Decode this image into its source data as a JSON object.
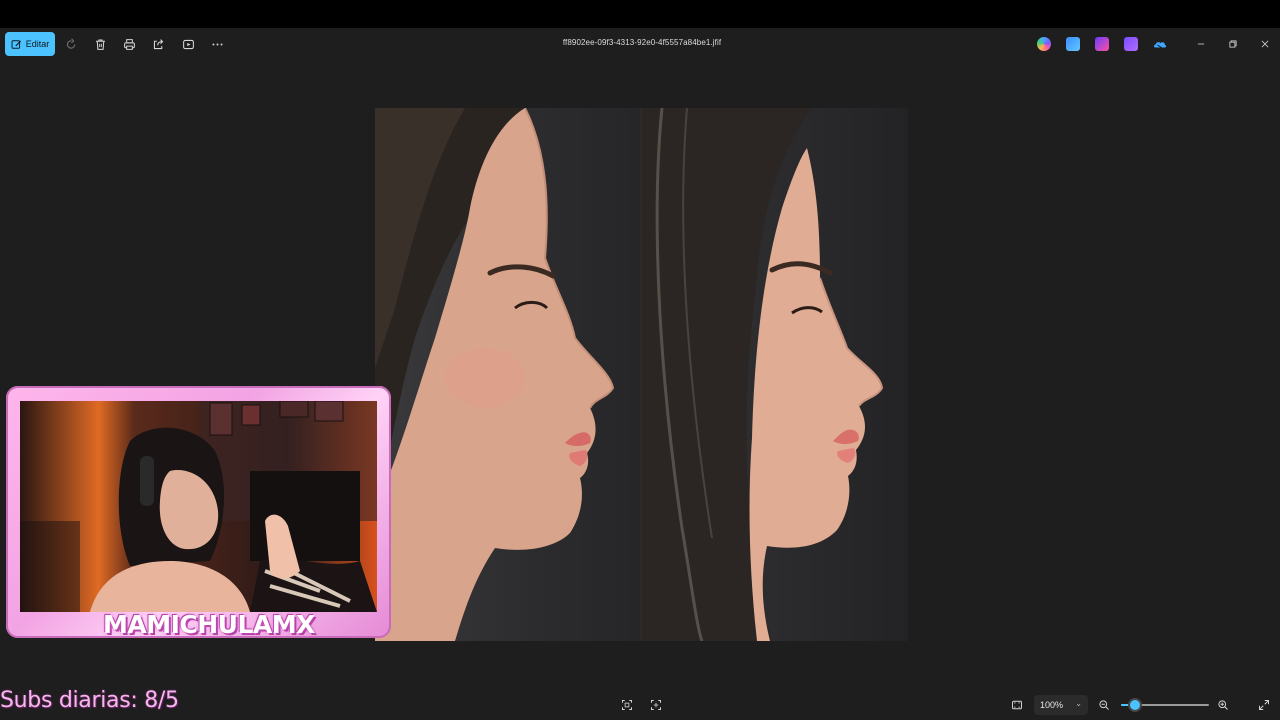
{
  "toolbar": {
    "edit_label": "Editar",
    "file_name": "ff8902ee-09f3-4313-92e0-4f5557a84be1.jfif"
  },
  "overlay": {
    "streamer_name": "MAMICHULAMX",
    "subs_text": "Subs diarias: 8/5"
  },
  "statusbar": {
    "zoom_label": "100%",
    "zoom_level": 0.16
  },
  "colors": {
    "accent": "#4cc2ff",
    "background": "#1e1e1e",
    "overlay_pink": "#f2a3e3"
  },
  "icons": {
    "toolbar": [
      "edit-icon",
      "rotate-icon",
      "delete-icon",
      "print-icon",
      "share-icon",
      "slideshow-icon",
      "more-icon"
    ],
    "apps": [
      "copilot-icon",
      "paint-icon",
      "clipchamp-icon",
      "designer-icon",
      "onedrive-icon"
    ],
    "window": [
      "minimize-icon",
      "restore-icon",
      "close-icon"
    ],
    "bottom": [
      "fit-icon",
      "crop-icon",
      "fullscreen-frame-icon",
      "zoom-out-icon",
      "zoom-in-icon",
      "expand-icon"
    ]
  }
}
